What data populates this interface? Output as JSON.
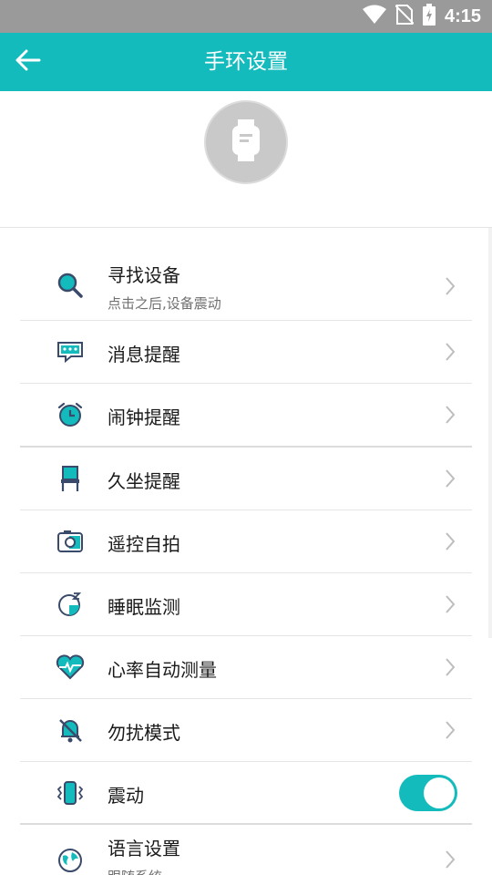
{
  "status_bar": {
    "time": "4:15",
    "icons": [
      "wifi-icon",
      "no-sim-icon",
      "battery-charging-icon"
    ]
  },
  "app_bar": {
    "title": "手环设置",
    "back_icon": "arrow-left-icon"
  },
  "header": {
    "device_icon": "smartwatch-icon"
  },
  "settings": [
    {
      "label": "寻找设备",
      "sub": "点击之后,设备震动",
      "icon": "magnifier-icon",
      "control": "chevron"
    },
    {
      "label": "消息提醒",
      "icon": "message-icon",
      "control": "chevron"
    },
    {
      "label": "闹钟提醒",
      "icon": "alarm-clock-icon",
      "control": "chevron"
    },
    {
      "label": "久坐提醒",
      "icon": "chair-icon",
      "control": "chevron"
    },
    {
      "label": "遥控自拍",
      "icon": "camera-icon",
      "control": "chevron"
    },
    {
      "label": "睡眠监测",
      "icon": "sleep-moon-icon",
      "control": "chevron"
    },
    {
      "label": "心率自动测量",
      "icon": "heart-rate-icon",
      "control": "chevron"
    },
    {
      "label": "勿扰模式",
      "icon": "bell-off-icon",
      "control": "chevron"
    },
    {
      "label": "震动",
      "icon": "vibration-icon",
      "control": "toggle",
      "value": true
    },
    {
      "label": "语言设置",
      "sub": "跟随系统",
      "icon": "globe-icon",
      "control": "chevron"
    }
  ],
  "colors": {
    "accent": "#14bbbd",
    "status_bar": "#9a9a9a",
    "icon_dark": "#3a4a6a"
  }
}
